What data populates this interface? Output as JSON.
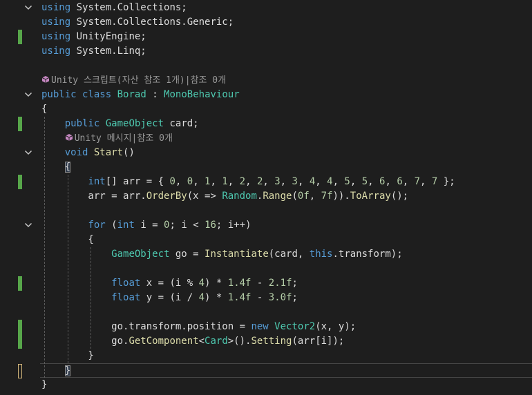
{
  "editor": {
    "language": "C#",
    "colors": {
      "background": "#1e1e1e",
      "default_text": "#dcdcdc",
      "keyword": "#569cd6",
      "type": "#4ec9b0",
      "method": "#dcdcaa",
      "number": "#b5cea8",
      "hint": "#999999",
      "hint_icon": "#c586c0",
      "change_saved": "#57a64a",
      "change_unsaved": "#d7ba7d",
      "fold_chevron": "#c8c8c8"
    },
    "lines": [
      {
        "fold": true,
        "change": null,
        "tokens": [
          [
            "using",
            "keyword"
          ],
          [
            " System.Collections;",
            "plain"
          ]
        ]
      },
      {
        "fold": false,
        "change": null,
        "tokens": [
          [
            "using",
            "keyword"
          ],
          [
            " System.Collections.Generic;",
            "plain"
          ]
        ]
      },
      {
        "fold": false,
        "change": "saved",
        "tokens": [
          [
            "using",
            "keyword"
          ],
          [
            " UnityEngine;",
            "plain"
          ]
        ]
      },
      {
        "fold": false,
        "change": null,
        "tokens": [
          [
            "using",
            "keyword"
          ],
          [
            " System.Linq;",
            "plain"
          ]
        ]
      },
      {
        "fold": false,
        "change": null,
        "tokens": []
      },
      {
        "fold": false,
        "change": null,
        "hint": true,
        "tokens": [
          [
            "Unity 스크립트(자산 참조 1개)|참조 0개",
            "hint"
          ]
        ]
      },
      {
        "fold": true,
        "change": null,
        "tokens": [
          [
            "public",
            "keyword"
          ],
          [
            " ",
            "plain"
          ],
          [
            "class",
            "keyword"
          ],
          [
            " ",
            "plain"
          ],
          [
            "Borad",
            "type"
          ],
          [
            " : ",
            "plain"
          ],
          [
            "MonoBehaviour",
            "type"
          ]
        ]
      },
      {
        "fold": false,
        "change": null,
        "tokens": [
          [
            "{",
            "plain"
          ]
        ]
      },
      {
        "fold": false,
        "change": "saved",
        "tokens": [
          [
            "    ",
            "plain"
          ],
          [
            "public",
            "keyword"
          ],
          [
            " ",
            "plain"
          ],
          [
            "GameObject",
            "type"
          ],
          [
            " card;",
            "plain"
          ]
        ]
      },
      {
        "fold": false,
        "change": null,
        "hint": true,
        "indent": "    ",
        "tokens": [
          [
            "Unity 메시지|참조 0개",
            "hint"
          ]
        ]
      },
      {
        "fold": true,
        "change": null,
        "tokens": [
          [
            "    ",
            "plain"
          ],
          [
            "void",
            "keyword"
          ],
          [
            " ",
            "plain"
          ],
          [
            "Start",
            "method"
          ],
          [
            "()",
            "plain"
          ]
        ]
      },
      {
        "fold": false,
        "change": null,
        "tokens": [
          [
            "    ",
            "plain"
          ],
          [
            "{",
            "match"
          ]
        ]
      },
      {
        "fold": false,
        "change": "saved",
        "tokens": [
          [
            "        ",
            "plain"
          ],
          [
            "int",
            "keyword"
          ],
          [
            "[] arr = { ",
            "plain"
          ],
          [
            "0",
            "number"
          ],
          [
            ", ",
            "plain"
          ],
          [
            "0",
            "number"
          ],
          [
            ", ",
            "plain"
          ],
          [
            "1",
            "number"
          ],
          [
            ", ",
            "plain"
          ],
          [
            "1",
            "number"
          ],
          [
            ", ",
            "plain"
          ],
          [
            "2",
            "number"
          ],
          [
            ", ",
            "plain"
          ],
          [
            "2",
            "number"
          ],
          [
            ", ",
            "plain"
          ],
          [
            "3",
            "number"
          ],
          [
            ", ",
            "plain"
          ],
          [
            "3",
            "number"
          ],
          [
            ", ",
            "plain"
          ],
          [
            "4",
            "number"
          ],
          [
            ", ",
            "plain"
          ],
          [
            "4",
            "number"
          ],
          [
            ", ",
            "plain"
          ],
          [
            "5",
            "number"
          ],
          [
            ", ",
            "plain"
          ],
          [
            "5",
            "number"
          ],
          [
            ", ",
            "plain"
          ],
          [
            "6",
            "number"
          ],
          [
            ", ",
            "plain"
          ],
          [
            "6",
            "number"
          ],
          [
            ", ",
            "plain"
          ],
          [
            "7",
            "number"
          ],
          [
            ", ",
            "plain"
          ],
          [
            "7",
            "number"
          ],
          [
            " };",
            "plain"
          ]
        ]
      },
      {
        "fold": false,
        "change": null,
        "tokens": [
          [
            "        arr = arr.",
            "plain"
          ],
          [
            "OrderBy",
            "method"
          ],
          [
            "(x => ",
            "plain"
          ],
          [
            "Random",
            "type"
          ],
          [
            ".",
            "plain"
          ],
          [
            "Range",
            "method"
          ],
          [
            "(",
            "plain"
          ],
          [
            "0f",
            "number"
          ],
          [
            ", ",
            "plain"
          ],
          [
            "7f",
            "number"
          ],
          [
            ")).",
            "plain"
          ],
          [
            "ToArray",
            "method"
          ],
          [
            "();",
            "plain"
          ]
        ]
      },
      {
        "fold": false,
        "change": null,
        "tokens": []
      },
      {
        "fold": true,
        "change": null,
        "tokens": [
          [
            "        ",
            "plain"
          ],
          [
            "for",
            "keyword"
          ],
          [
            " (",
            "plain"
          ],
          [
            "int",
            "keyword"
          ],
          [
            " i = ",
            "plain"
          ],
          [
            "0",
            "number"
          ],
          [
            "; i < ",
            "plain"
          ],
          [
            "16",
            "number"
          ],
          [
            "; i++)",
            "plain"
          ]
        ]
      },
      {
        "fold": false,
        "change": null,
        "tokens": [
          [
            "        {",
            "plain"
          ]
        ]
      },
      {
        "fold": false,
        "change": null,
        "tokens": [
          [
            "            ",
            "plain"
          ],
          [
            "GameObject",
            "type"
          ],
          [
            " go = ",
            "plain"
          ],
          [
            "Instantiate",
            "method"
          ],
          [
            "(card, ",
            "plain"
          ],
          [
            "this",
            "keyword"
          ],
          [
            ".transform);",
            "plain"
          ]
        ]
      },
      {
        "fold": false,
        "change": null,
        "tokens": []
      },
      {
        "fold": false,
        "change": "saved",
        "tokens": [
          [
            "            ",
            "plain"
          ],
          [
            "float",
            "keyword"
          ],
          [
            " x = (i % ",
            "plain"
          ],
          [
            "4",
            "number"
          ],
          [
            ") * ",
            "plain"
          ],
          [
            "1.4f",
            "number"
          ],
          [
            " - ",
            "plain"
          ],
          [
            "2.1f",
            "number"
          ],
          [
            ";",
            "plain"
          ]
        ]
      },
      {
        "fold": false,
        "change": null,
        "tokens": [
          [
            "            ",
            "plain"
          ],
          [
            "float",
            "keyword"
          ],
          [
            " y = (i / ",
            "plain"
          ],
          [
            "4",
            "number"
          ],
          [
            ") * ",
            "plain"
          ],
          [
            "1.4f",
            "number"
          ],
          [
            " - ",
            "plain"
          ],
          [
            "3.0f",
            "number"
          ],
          [
            ";",
            "plain"
          ]
        ]
      },
      {
        "fold": false,
        "change": null,
        "tokens": []
      },
      {
        "fold": false,
        "change": "saved",
        "tokens": [
          [
            "            go.transform.position = ",
            "plain"
          ],
          [
            "new",
            "keyword"
          ],
          [
            " ",
            "plain"
          ],
          [
            "Vector2",
            "type"
          ],
          [
            "(x, y);",
            "plain"
          ]
        ]
      },
      {
        "fold": false,
        "change": "saved",
        "tokens": [
          [
            "            go.",
            "plain"
          ],
          [
            "GetComponent",
            "method"
          ],
          [
            "<",
            "plain"
          ],
          [
            "Card",
            "type"
          ],
          [
            ">().",
            "plain"
          ],
          [
            "Setting",
            "method"
          ],
          [
            "(arr[i]);",
            "plain"
          ]
        ]
      },
      {
        "fold": false,
        "change": null,
        "tokens": [
          [
            "        }",
            "plain"
          ]
        ]
      },
      {
        "fold": false,
        "change": "unsaved",
        "current": true,
        "tokens": [
          [
            "    ",
            "plain"
          ],
          [
            "}",
            "match"
          ]
        ]
      },
      {
        "fold": false,
        "change": null,
        "tokens": [
          [
            "}",
            "plain"
          ]
        ]
      }
    ],
    "icons": {
      "fold": "chevron-down-icon",
      "codelens": "unity-cube-icon"
    }
  }
}
